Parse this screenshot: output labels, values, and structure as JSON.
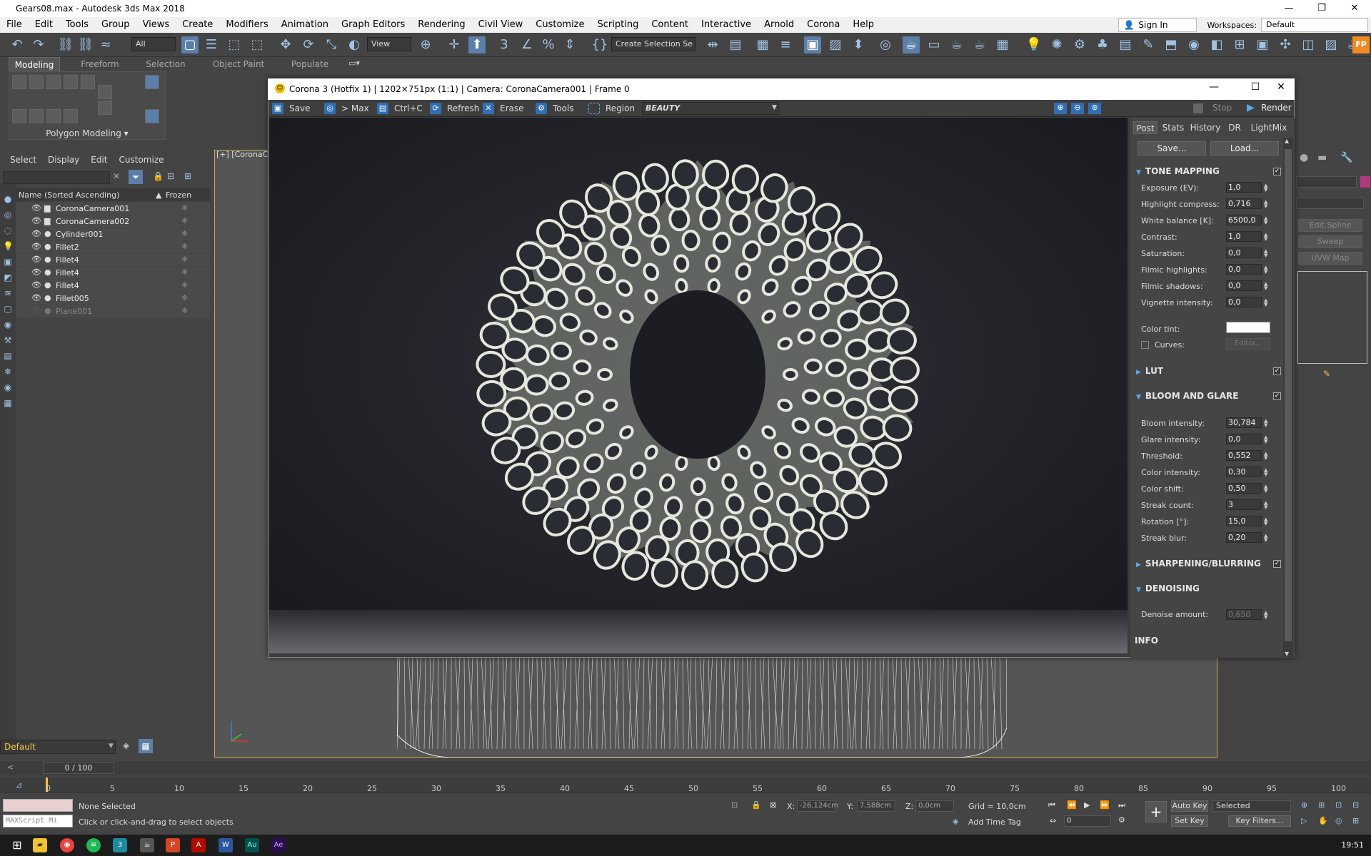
{
  "app": {
    "title": "Gears08.max - Autodesk 3ds Max 2018",
    "win_min": "—",
    "win_max": "❐",
    "win_close": "✕"
  },
  "menu": [
    "File",
    "Edit",
    "Tools",
    "Group",
    "Views",
    "Create",
    "Modifiers",
    "Animation",
    "Graph Editors",
    "Rendering",
    "Civil View",
    "Customize",
    "Scripting",
    "Content",
    "Interactive",
    "Arnold",
    "Corona",
    "Help"
  ],
  "account": {
    "signin": "Sign In",
    "workspaces_label": "Workspaces:",
    "workspace": "Default"
  },
  "toolbar": {
    "filter": "All",
    "view": "View",
    "selection_set": "Create Selection Se"
  },
  "ribbon": {
    "tabs": [
      "Modeling",
      "Freeform",
      "Selection",
      "Object Paint",
      "Populate"
    ],
    "active": "Modeling",
    "panel": "Polygon Modeling"
  },
  "scene_explorer": {
    "menu": [
      "Select",
      "Display",
      "Edit",
      "Customize"
    ],
    "col_name": "Name (Sorted Ascending)",
    "col_frozen": "Frozen",
    "items": [
      {
        "name": "CoronaCamera001",
        "type": "camera"
      },
      {
        "name": "CoronaCamera002",
        "type": "camera"
      },
      {
        "name": "Cylinder001",
        "type": "object"
      },
      {
        "name": "Fillet2",
        "type": "object"
      },
      {
        "name": "Fillet4",
        "type": "object"
      },
      {
        "name": "Fillet4",
        "type": "object"
      },
      {
        "name": "Fillet4",
        "type": "object"
      },
      {
        "name": "Fillet005",
        "type": "object"
      },
      {
        "name": "Plane001",
        "type": "hidden"
      }
    ],
    "layer": "Default"
  },
  "viewport": {
    "label": "[+] [CoronaC"
  },
  "vfb": {
    "title": "Corona 3 (Hotfix 1) | 1202×751px (1:1) | Camera: CoronaCamera001 | Frame 0",
    "buttons": {
      "save": "Save",
      "tomax": "> Max",
      "copy": "Ctrl+C",
      "refresh": "Refresh",
      "erase": "Erase",
      "tools": "Tools",
      "region": "Region"
    },
    "pass": "BEAUTY",
    "stop": "Stop",
    "render": "Render",
    "tabs": [
      "Post",
      "Stats",
      "History",
      "DR",
      "LightMix"
    ],
    "save_btn": "Save...",
    "load_btn": "Load...",
    "sections": {
      "tone_mapping": "TONE MAPPING",
      "lut": "LUT",
      "bloom": "BLOOM AND GLARE",
      "sharpen": "SHARPENING/BLURRING",
      "denoise": "DENOISING",
      "info": "INFO"
    },
    "tone": [
      {
        "label": "Exposure (EV):",
        "value": "1,0"
      },
      {
        "label": "Highlight compress:",
        "value": "0,716"
      },
      {
        "label": "White balance [K]:",
        "value": "6500,0"
      },
      {
        "label": "Contrast:",
        "value": "1,0"
      },
      {
        "label": "Saturation:",
        "value": "0,0"
      },
      {
        "label": "Filmic highlights:",
        "value": "0,0"
      },
      {
        "label": "Filmic shadows:",
        "value": "0,0"
      },
      {
        "label": "Vignette intensity:",
        "value": "0,0"
      }
    ],
    "color_tint_label": "Color tint:",
    "curves_label": "Curves:",
    "curves_editor": "Editor...",
    "bloom_rows": [
      {
        "label": "Bloom intensity:",
        "value": "30,784"
      },
      {
        "label": "Glare intensity:",
        "value": "0,0"
      },
      {
        "label": "Threshold:",
        "value": "0,552"
      },
      {
        "label": "Color intensity:",
        "value": "0,30"
      },
      {
        "label": "Color shift:",
        "value": "0,50"
      },
      {
        "label": "Streak count:",
        "value": "3"
      },
      {
        "label": "Rotation [°]:",
        "value": "15,0"
      },
      {
        "label": "Streak blur:",
        "value": "0,20"
      }
    ],
    "denoise_label": "Denoise amount:",
    "denoise_value": "0,650"
  },
  "command_panel": {
    "buttons": [
      "Edit Spline",
      "Sweep",
      "UVW Map"
    ]
  },
  "timeline": {
    "frame": "0 / 100",
    "ticks": [
      "0",
      "5",
      "10",
      "15",
      "20",
      "25",
      "30",
      "35",
      "40",
      "45",
      "50",
      "55",
      "60",
      "65",
      "70",
      "75",
      "80",
      "85",
      "90",
      "95",
      "100"
    ]
  },
  "status": {
    "selection": "None Selected",
    "prompt": "Click or click-and-drag to select objects",
    "maxscript": "MAXScript Mi",
    "x_label": "X:",
    "x": "-26,124cm",
    "y_label": "Y:",
    "y": "7,588cm",
    "z_label": "Z:",
    "z": "0,0cm",
    "grid": "Grid = 10,0cm",
    "add_time_tag": "Add Time Tag",
    "auto_key": "Auto Key",
    "set_key": "Set Key",
    "key_mode": "Selected",
    "key_filters": "Key Filters...",
    "frame_field": "0"
  },
  "taskbar": {
    "clock": "19:51"
  }
}
